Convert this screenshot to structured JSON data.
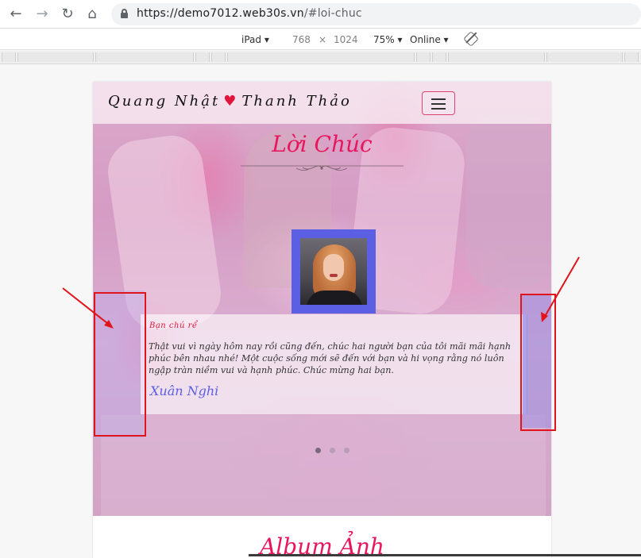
{
  "browser": {
    "url_host": "https://demo7012.web30s.vn",
    "url_path": "/#loi-chuc",
    "back_icon": "back-arrow-icon",
    "forward_icon": "forward-arrow-icon",
    "reload_icon": "reload-icon",
    "home_icon": "home-icon"
  },
  "device_toolbar": {
    "device": "iPad",
    "width": "768",
    "times": "×",
    "height": "1024",
    "zoom": "75%",
    "network": "Online",
    "caret": "▾"
  },
  "site": {
    "brand_left": "Quang Nhật",
    "brand_right": "Thanh Thảo",
    "brand_heart": "♥",
    "section_title": "Lời Chúc",
    "album_title": "Album Ảnh"
  },
  "testimonial": {
    "name": "Bạn chú rể",
    "message": "Thật vui vì ngày hôm nay rồi cũng đến, chúc hai người bạn của tôi mãi mãi hạnh phúc bên nhau nhé! Một cuộc sống mới sẽ đến với bạn và hi vọng rằng nó luôn ngập tràn niềm vui và hạnh phúc. Chúc mừng hai bạn.",
    "signature": "Xuân Nghi",
    "slide_count": 3,
    "active_slide": 1
  },
  "colors": {
    "accent": "#e8175d",
    "heart": "#e0143c",
    "frame": "#5b5fe3",
    "annotation": "#e0141b"
  }
}
